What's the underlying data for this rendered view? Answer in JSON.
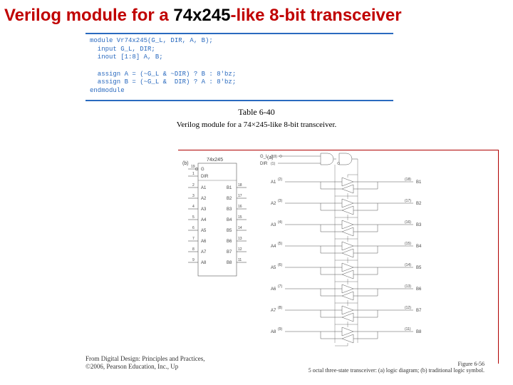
{
  "title": {
    "pre": "Verilog module for a ",
    "mid": "74x245",
    "post": "-like 8-bit transceiver"
  },
  "code": {
    "l1": "module Vr74x245(G_L, DIR, A, B);",
    "l2": "  input G_L, DIR;",
    "l3": "  inout [1:8] A, B;",
    "l4": "",
    "l5": "  assign A = (~G_L & ~DIR) ? B : 8'bz;",
    "l6": "  assign B = (~G_L &  DIR) ? A : 8'bz;",
    "l7": "endmodule"
  },
  "caption": {
    "table": "Table 6-40",
    "desc": "Verilog module for a 74×245-like 8-bit transceiver."
  },
  "symbol": {
    "part": "74x245",
    "ctrl": [
      "G",
      "DIR"
    ],
    "ctrl_pins": [
      "19",
      "1"
    ],
    "a": [
      "A1",
      "A2",
      "A3",
      "A4",
      "A5",
      "A6",
      "A7",
      "A8"
    ],
    "a_pins": [
      "2",
      "3",
      "4",
      "5",
      "6",
      "7",
      "8",
      "9"
    ],
    "b": [
      "B1",
      "B2",
      "B3",
      "B4",
      "B5",
      "B6",
      "B7",
      "B8"
    ],
    "b_pins": [
      "18",
      "17",
      "16",
      "15",
      "14",
      "13",
      "12",
      "11"
    ]
  },
  "logic": {
    "ctrl": [
      "G_L",
      "DIR"
    ],
    "ctrl_pins": [
      "(19)",
      "(1)"
    ],
    "a": [
      "A1",
      "A2",
      "A3",
      "A4",
      "A5",
      "A6",
      "A7",
      "A8"
    ],
    "a_pins": [
      "(2)",
      "(3)",
      "(4)",
      "(5)",
      "(6)",
      "(7)",
      "(8)",
      "(9)"
    ],
    "b": [
      "B1",
      "B2",
      "B3",
      "B4",
      "B5",
      "B6",
      "B7",
      "B8"
    ],
    "b_pins": [
      "(18)",
      "(17)",
      "(16)",
      "(15)",
      "(14)",
      "(13)",
      "(12)",
      "(11)"
    ]
  },
  "footer": {
    "l1": "From Digital Design: Principles and Practices,",
    "l2": "©2006, Pearson Education, Inc., Up"
  },
  "figcap": {
    "num": "Figure 6-56",
    "txt": "5 octal three-state transceiver: (a) logic diagram; (b) traditional logic symbol."
  }
}
